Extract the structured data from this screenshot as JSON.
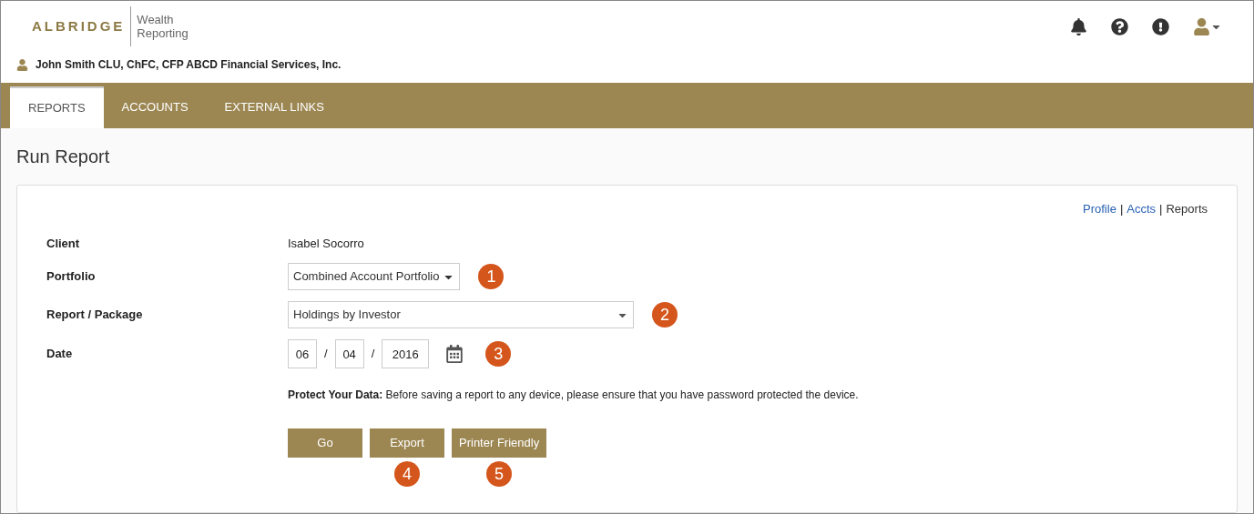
{
  "logo": {
    "brand": "ALBRIDGE",
    "product_line1": "Wealth",
    "product_line2": "Reporting"
  },
  "user": {
    "name": "John Smith CLU, ChFC, CFP ABCD Financial Services, Inc."
  },
  "tabs": [
    {
      "label": "REPORTS",
      "selected": true
    },
    {
      "label": "ACCOUNTS",
      "selected": false
    },
    {
      "label": "EXTERNAL LINKS",
      "selected": false
    }
  ],
  "page_title": "Run Report",
  "breadcrumb_separator": "|",
  "breadcrumb": [
    {
      "label": "Profile",
      "selected": false
    },
    {
      "label": "Accts",
      "selected": false
    },
    {
      "label": "Reports",
      "selected": true
    }
  ],
  "form": {
    "client_label": "Client",
    "client_value": "Isabel Socorro",
    "portfolio_label": "Portfolio",
    "portfolio_value": "Combined Account Portfolio",
    "portfolio_callout": "1",
    "report_label": "Report / Package",
    "report_value": "Holdings by Investor",
    "report_callout": "2",
    "date_label": "Date",
    "month": "06",
    "day": "04",
    "year": "2016",
    "date_separator": "/",
    "date_callout": "3",
    "notice": "**Protect Your Data:** Before saving a report to any device, please ensure that you have password protected the device."
  },
  "buttons": [
    {
      "label": "Go"
    },
    {
      "label": "Export",
      "callout": "4"
    },
    {
      "label": "Printer Friendly",
      "callout": "5"
    }
  ]
}
